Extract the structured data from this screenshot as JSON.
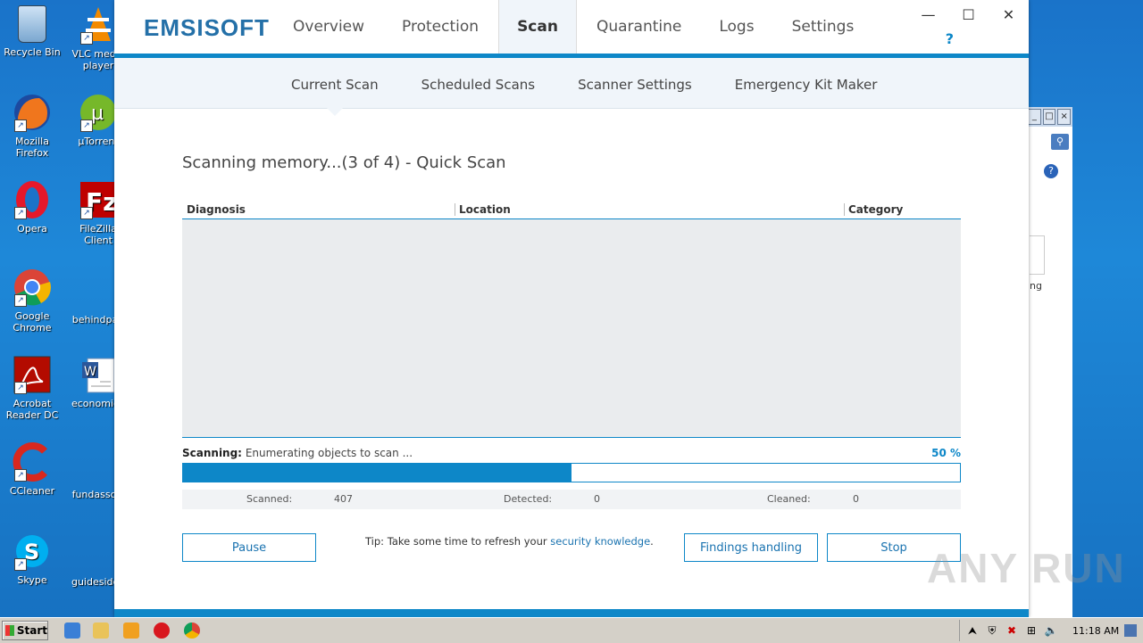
{
  "desktop": {
    "icons": [
      {
        "label": "Recycle Bin"
      },
      {
        "label": "VLC media player"
      },
      {
        "label": "Mozilla Firefox"
      },
      {
        "label": "µTorrent"
      },
      {
        "label": "Opera"
      },
      {
        "label": "FileZilla Client"
      },
      {
        "label": "Google Chrome"
      },
      {
        "label": "behindpau"
      },
      {
        "label": "Acrobat Reader DC"
      },
      {
        "label": "economicg"
      },
      {
        "label": "CCleaner"
      },
      {
        "label": "fundassoci"
      },
      {
        "label": "Skype"
      },
      {
        "label": "guidesidea"
      }
    ]
  },
  "bg_window": {
    "text": "ng"
  },
  "app": {
    "logo": "EMSISOFT",
    "main_tabs": [
      {
        "label": "Overview"
      },
      {
        "label": "Protection"
      },
      {
        "label": "Scan"
      },
      {
        "label": "Quarantine"
      },
      {
        "label": "Logs"
      },
      {
        "label": "Settings"
      }
    ],
    "help": "?",
    "window_controls": {
      "minimize": "—",
      "maximize": "☐",
      "close": "✕"
    },
    "sub_tabs": [
      {
        "label": "Current Scan"
      },
      {
        "label": "Scheduled Scans"
      },
      {
        "label": "Scanner Settings"
      },
      {
        "label": "Emergency Kit Maker"
      }
    ],
    "scan_title": "Scanning memory...(3 of 4) - Quick Scan",
    "table": {
      "columns": [
        "Diagnosis",
        "Location",
        "Category"
      ]
    },
    "status": {
      "label": "Scanning:",
      "text": "Enumerating objects to scan ...",
      "percent_text": "50 %",
      "progress": 0.5
    },
    "counts": {
      "scanned_label": "Scanned:",
      "scanned": "407",
      "detected_label": "Detected:",
      "detected": "0",
      "cleaned_label": "Cleaned:",
      "cleaned": "0"
    },
    "buttons": {
      "pause": "Pause",
      "findings": "Findings handling",
      "stop": "Stop"
    },
    "tip": {
      "prefix": "Tip: Take some time to refresh your ",
      "link": "security knowledge",
      "suffix": "."
    }
  },
  "watermark": "ANY RUN",
  "taskbar": {
    "start": "Start",
    "clock": "11:18 AM"
  }
}
